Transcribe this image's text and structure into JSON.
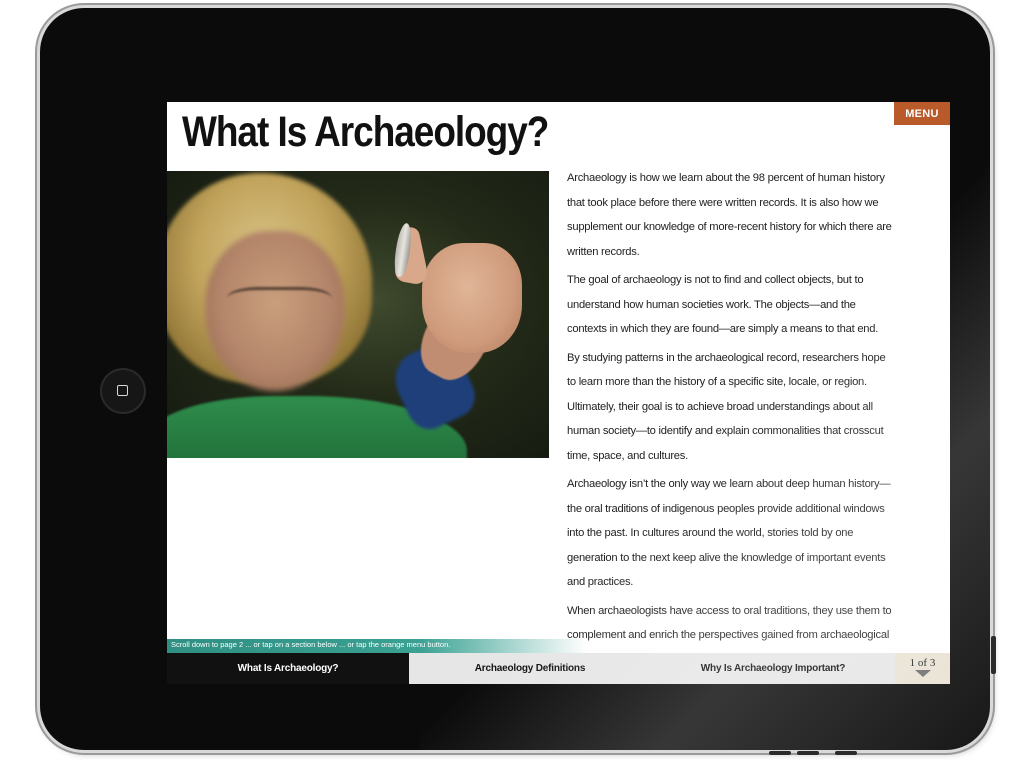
{
  "page": {
    "title": "What Is Archaeology?",
    "menu_label": "MENU"
  },
  "hero_image": {
    "alt": "photo of a girl holding a stone arrowhead"
  },
  "article": {
    "paragraphs": [
      "Archaeology is how we learn about the 98 percent of human history that took place before there were written records. It is also how we supplement our knowledge of more-recent history for which there are written records.",
      "The goal of archaeology is not to find and collect objects, but to understand how human societies work. The objects—and the contexts in which they are found—are simply a means to that end.",
      "By studying patterns in the archaeological record, researchers hope to learn more than the history of a specific site, locale, or region. Ultimately, their goal is to achieve broad understandings about all human society—to identify and explain commonalities that crosscut time, space, and cultures.",
      "Archaeology isn’t the only way we learn about deep human history—the oral traditions of indigenous peoples provide additional windows into the past. In cultures around the world, stories told by one generation to the next keep alive the knowledge of important events and practices.",
      "When archaeologists have access to oral traditions, they use them to complement and enrich the perspectives gained from archaeological research. But for most people, archaeology remains the primary way they learn about peoples and cultures of the distant past."
    ]
  },
  "scroll_hint": "Scroll down to page 2 ... or tap on a section below ... or tap the orange menu button.",
  "tabs": [
    {
      "label": "What Is Archaeology?",
      "active": true
    },
    {
      "label": "Archaeology Definitions",
      "active": false
    },
    {
      "label": "Why Is Archaeology Important?",
      "active": false
    }
  ],
  "pager": {
    "text": "1 of 3",
    "next_icon": "down-triangle-icon"
  },
  "colors": {
    "menu_accent": "#b95a2a",
    "active_tab": "#111111",
    "scroll_hint": "#3aa193"
  }
}
